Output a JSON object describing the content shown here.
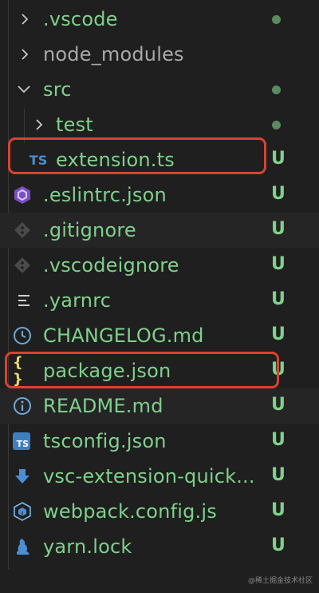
{
  "tree": {
    "items": [
      {
        "label": ".vscode",
        "icon": "chevron-right-icon",
        "status": "dot"
      },
      {
        "label": "node_modules",
        "icon": "chevron-right-icon",
        "status": ""
      },
      {
        "label": "src",
        "icon": "chevron-down-icon",
        "status": "dot"
      },
      {
        "label": "test",
        "icon": "chevron-right-icon",
        "status": "dot"
      },
      {
        "label": "extension.ts",
        "icon": "typescript-icon",
        "icon_text": "TS",
        "status": "U"
      },
      {
        "label": ".eslintrc.json",
        "icon": "eslint-icon",
        "status": "U"
      },
      {
        "label": ".gitignore",
        "icon": "git-icon",
        "status": "U"
      },
      {
        "label": ".vscodeignore",
        "icon": "vscode-ignore-icon",
        "status": "U"
      },
      {
        "label": ".yarnrc",
        "icon": "lines-icon",
        "status": "U"
      },
      {
        "label": "CHANGELOG.md",
        "icon": "clock-icon",
        "status": "U"
      },
      {
        "label": "package.json",
        "icon": "json-braces-icon",
        "icon_text": "{ }",
        "status": "U"
      },
      {
        "label": "README.md",
        "icon": "info-icon",
        "status": "U"
      },
      {
        "label": "tsconfig.json",
        "icon": "tsconfig-icon",
        "icon_text": "TS",
        "status": "U"
      },
      {
        "label": "vsc-extension-quick...",
        "icon": "download-arrow-icon",
        "status": "U"
      },
      {
        "label": "webpack.config.js",
        "icon": "webpack-icon",
        "status": "U"
      },
      {
        "label": "yarn.lock",
        "icon": "yarn-icon",
        "status": "U"
      }
    ]
  },
  "watermark": "@稀土掘金技术社区",
  "colors": {
    "background": "#1f1f1f",
    "untracked": "#7fd18c",
    "highlight": "#d9432f"
  }
}
